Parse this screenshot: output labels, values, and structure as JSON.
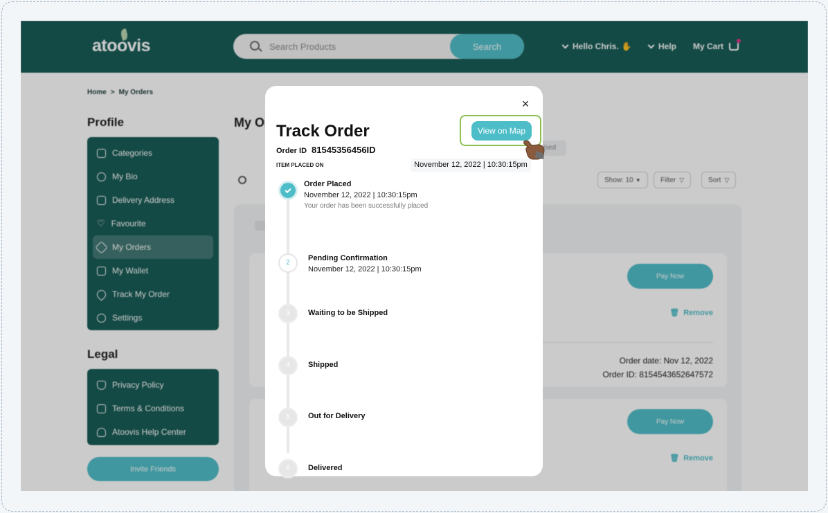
{
  "header": {
    "logo": "atoovis",
    "search_placeholder": "Search Products",
    "search_button": "Search",
    "greeting": "Hello Chris.",
    "help": "Help",
    "cart": "My Cart"
  },
  "breadcrumb": {
    "home": "Home",
    "separator": ">",
    "current": "My Orders"
  },
  "profile": {
    "title": "Profile",
    "items": [
      {
        "label": "Categories",
        "icon": "categories-icon"
      },
      {
        "label": "My Bio",
        "icon": "user-icon"
      },
      {
        "label": "Delivery Address",
        "icon": "address-icon"
      },
      {
        "label": "Favourite",
        "icon": "heart-icon"
      },
      {
        "label": "My Orders",
        "icon": "orders-icon"
      },
      {
        "label": "My Wallet",
        "icon": "wallet-icon"
      },
      {
        "label": "Track My Order",
        "icon": "location-icon"
      },
      {
        "label": "Settings",
        "icon": "gear-icon"
      }
    ]
  },
  "legal": {
    "title": "Legal",
    "items": [
      {
        "label": "Privacy Policy",
        "icon": "shield-icon"
      },
      {
        "label": "Terms & Conditions",
        "icon": "document-icon"
      },
      {
        "label": "Atoovis Help Center",
        "icon": "headset-icon"
      }
    ]
  },
  "invite_button": "Invite Friends",
  "main": {
    "title": "My Orders",
    "tab_hint": "ised",
    "show": "Show: 10",
    "filter": "Filter",
    "sort": "Sort",
    "orders": [
      {
        "pay": "Pay Now",
        "remove": "Remove",
        "date": "Order date: Nov 12, 2022",
        "id": "Order ID: 8154543652647572"
      },
      {
        "pay": "Pay Now",
        "remove": "Remove"
      }
    ]
  },
  "modal": {
    "title": "Track Order",
    "order_id_label": "Order ID",
    "order_id": "81545356456ID",
    "placed_label": "ITEM PLACED ON",
    "placed_date": "November 12, 2022 | 10:30:15pm",
    "map_button": "View on Map",
    "close": "×",
    "steps": [
      {
        "num": "1",
        "title": "Order Placed",
        "date": "November 12, 2022 | 10:30:15pm",
        "desc": "Your order has been successfully placed",
        "status": "done"
      },
      {
        "num": "2",
        "title": "Pending Confirmation",
        "date": "November 12, 2022 | 10:30:15pm",
        "status": "current"
      },
      {
        "num": "3",
        "title": "Waiting to be Shipped",
        "status": "pending"
      },
      {
        "num": "4",
        "title": "Shipped",
        "status": "pending"
      },
      {
        "num": "5",
        "title": "Out for Delivery",
        "status": "pending"
      },
      {
        "num": "6",
        "title": "Delivered",
        "status": "pending"
      }
    ]
  },
  "colors": {
    "primary": "#155a54",
    "accent": "#4dbdc8",
    "highlight": "#8cc152"
  }
}
